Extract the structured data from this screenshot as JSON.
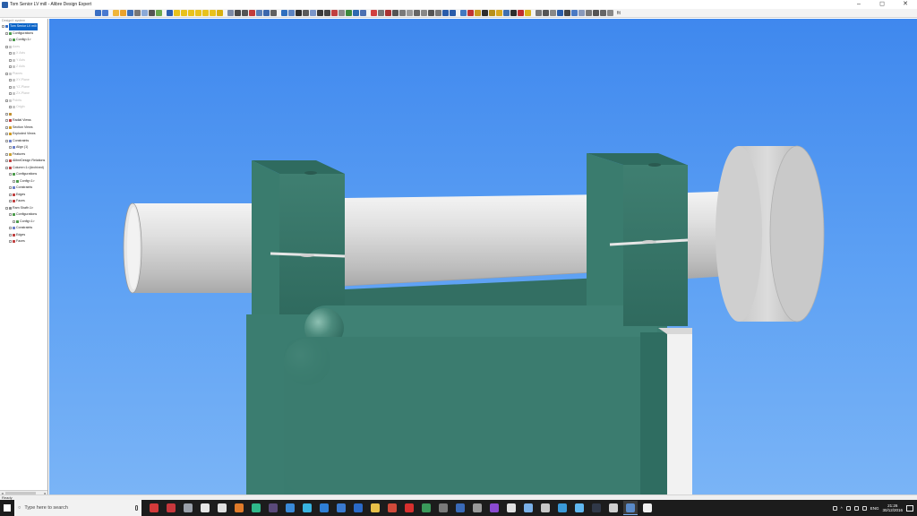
{
  "window": {
    "title": "Tom Senior LV mill - Alibre Design Expert",
    "controls": [
      "–",
      "◻",
      "✕"
    ]
  },
  "toolbar": {
    "zoom_label": "fit",
    "buttons": [
      {
        "icon": "select-icon",
        "color": "#3a6fc4"
      },
      {
        "icon": "undo-icon",
        "color": "#4a7ad0"
      },
      {
        "sep": true
      },
      {
        "icon": "new-icon",
        "color": "#f0b63a"
      },
      {
        "icon": "open-folder-icon",
        "color": "#e9a22e"
      },
      {
        "icon": "save-icon",
        "color": "#3d6fb8"
      },
      {
        "icon": "print-icon",
        "color": "#777777"
      },
      {
        "icon": "sphere-icon",
        "color": "#8aa9d8"
      },
      {
        "icon": "cut-icon",
        "color": "#555555"
      },
      {
        "icon": "leaf-icon",
        "color": "#6aa84f"
      },
      {
        "sep": true
      },
      {
        "icon": "pointer-icon",
        "color": "#2f5fb0"
      },
      {
        "icon": "frame-icon",
        "color": "#e8c21c"
      },
      {
        "icon": "frame-icon",
        "color": "#e8c21c"
      },
      {
        "icon": "frame-icon",
        "color": "#e8c21c"
      },
      {
        "icon": "frame-icon",
        "color": "#e8c21c"
      },
      {
        "icon": "frame-icon",
        "color": "#e8c21c"
      },
      {
        "icon": "frame-icon",
        "color": "#e8c21c"
      },
      {
        "icon": "frame-icon",
        "color": "#d8b010"
      },
      {
        "sep": true
      },
      {
        "icon": "grid-icon",
        "color": "#7c8aa6"
      },
      {
        "icon": "rotate-icon",
        "color": "#4a4a4a"
      },
      {
        "icon": "pan-icon",
        "color": "#555555"
      },
      {
        "icon": "flask-icon",
        "color": "#c23c3c"
      },
      {
        "icon": "view-icon",
        "color": "#5a7fb8"
      },
      {
        "icon": "view-icon",
        "color": "#3b67ad"
      },
      {
        "icon": "zoom-icon",
        "color": "#606060"
      },
      {
        "sep": true
      },
      {
        "icon": "measure-icon",
        "color": "#2e6fbf"
      },
      {
        "icon": "cube-icon",
        "color": "#5b83c2"
      },
      {
        "icon": "cube-icon",
        "color": "#2f2f2f"
      },
      {
        "icon": "cube-icon",
        "color": "#5a5a5a"
      },
      {
        "icon": "cube-icon",
        "color": "#7a95c8"
      },
      {
        "icon": "axis-icon",
        "color": "#3a3a3a"
      },
      {
        "icon": "axis-icon",
        "color": "#444444"
      },
      {
        "icon": "plane-icon",
        "color": "#c04040"
      },
      {
        "icon": "plane-icon",
        "color": "#8a8a8a"
      },
      {
        "icon": "curve-icon",
        "color": "#3c8a3c"
      },
      {
        "icon": "grid-icon",
        "color": "#2e6ab0"
      },
      {
        "icon": "grid-icon",
        "color": "#4c70b2"
      },
      {
        "sep": true
      },
      {
        "icon": "sketch-icon",
        "color": "#d04040"
      },
      {
        "icon": "render-icon",
        "color": "#777777"
      },
      {
        "icon": "render-icon",
        "color": "#aa3333"
      },
      {
        "icon": "render-icon",
        "color": "#555555"
      },
      {
        "icon": "render-icon",
        "color": "#7a7a7a"
      },
      {
        "icon": "render-icon",
        "color": "#999999"
      },
      {
        "icon": "render-icon",
        "color": "#666666"
      },
      {
        "icon": "render-icon",
        "color": "#888888"
      },
      {
        "icon": "render-icon",
        "color": "#555555"
      },
      {
        "icon": "render-icon",
        "color": "#777777"
      },
      {
        "icon": "render-icon",
        "color": "#2a5caa"
      },
      {
        "icon": "render-icon",
        "color": "#2a5caa"
      },
      {
        "sep": true
      },
      {
        "icon": "move-icon",
        "color": "#4478c0"
      },
      {
        "icon": "constraint-icon",
        "color": "#c03434"
      },
      {
        "icon": "constraint-icon",
        "color": "#c89a20"
      },
      {
        "icon": "constraint-icon",
        "color": "#2f2f2f"
      },
      {
        "icon": "constraint-icon",
        "color": "#b8901c"
      },
      {
        "icon": "constraint-icon",
        "color": "#d8a820"
      },
      {
        "icon": "constraint-icon",
        "color": "#3f6fb0"
      },
      {
        "icon": "constraint-icon",
        "color": "#2d2d2d"
      },
      {
        "icon": "constraint-icon",
        "color": "#c02e2e"
      },
      {
        "icon": "constraint-icon",
        "color": "#d9b21b"
      },
      {
        "sep": true
      },
      {
        "icon": "tool-icon",
        "color": "#777777"
      },
      {
        "icon": "tool-icon",
        "color": "#555555"
      },
      {
        "icon": "tool-icon",
        "color": "#888888"
      },
      {
        "icon": "tool-icon",
        "color": "#2a5ca8"
      },
      {
        "icon": "tool-icon",
        "color": "#444444"
      },
      {
        "icon": "tool-icon",
        "color": "#4a7ac4"
      },
      {
        "icon": "tool-icon",
        "color": "#8899bb"
      },
      {
        "icon": "tool-icon",
        "color": "#777777"
      },
      {
        "icon": "tool-icon",
        "color": "#555555"
      },
      {
        "icon": "tool-icon",
        "color": "#666666"
      },
      {
        "icon": "tool-icon",
        "color": "#888888"
      }
    ]
  },
  "sidebar": {
    "caption": "DesignX system",
    "tree": [
      {
        "label": "Tom Senior LV mill",
        "level": 0,
        "selected": true,
        "disabled": false,
        "icon_color": "#3a6fc4"
      },
      {
        "label": "Configurations",
        "level": 1,
        "selected": false,
        "disabled": false,
        "icon_color": "#4a9a4a"
      },
      {
        "label": "Config<1>",
        "level": 2,
        "selected": false,
        "disabled": false,
        "icon_color": "#4a9a4a"
      },
      {
        "label": "Axes",
        "level": 1,
        "selected": false,
        "disabled": true,
        "icon_color": "#c8c8c8"
      },
      {
        "label": "X Axis",
        "level": 2,
        "selected": false,
        "disabled": true,
        "icon_color": "#c8c8c8"
      },
      {
        "label": "Y Axis",
        "level": 2,
        "selected": false,
        "disabled": true,
        "icon_color": "#c8c8c8"
      },
      {
        "label": "Z Axis",
        "level": 2,
        "selected": false,
        "disabled": true,
        "icon_color": "#c8c8c8"
      },
      {
        "label": "Planes",
        "level": 1,
        "selected": false,
        "disabled": true,
        "icon_color": "#c8c8c8"
      },
      {
        "label": "XY-Plane",
        "level": 2,
        "selected": false,
        "disabled": true,
        "icon_color": "#c8c8c8"
      },
      {
        "label": "YZ-Plane",
        "level": 2,
        "selected": false,
        "disabled": true,
        "icon_color": "#c8c8c8"
      },
      {
        "label": "ZX-Plane",
        "level": 2,
        "selected": false,
        "disabled": true,
        "icon_color": "#c8c8c8"
      },
      {
        "label": "Points",
        "level": 1,
        "selected": false,
        "disabled": true,
        "icon_color": "#c8c8c8"
      },
      {
        "label": "Origin",
        "level": 2,
        "selected": false,
        "disabled": true,
        "icon_color": "#c8c8c8"
      },
      {
        "label": "",
        "level": 1,
        "selected": false,
        "disabled": false,
        "icon_color": "#c09030"
      },
      {
        "label": "Radial Views",
        "level": 1,
        "selected": false,
        "disabled": false,
        "icon_color": "#c04040"
      },
      {
        "label": "Section Views",
        "level": 1,
        "selected": false,
        "disabled": false,
        "icon_color": "#d09a20"
      },
      {
        "label": "Exploded Views",
        "level": 1,
        "selected": false,
        "disabled": false,
        "icon_color": "#d09a20"
      },
      {
        "label": "Constraints",
        "level": 1,
        "selected": false,
        "disabled": false,
        "icon_color": "#6a7fc8"
      },
      {
        "label": "Align (1)",
        "level": 2,
        "selected": false,
        "disabled": false,
        "icon_color": "#6a7fc8"
      },
      {
        "label": "Features",
        "level": 1,
        "selected": false,
        "disabled": false,
        "icon_color": "#c8a030"
      },
      {
        "label": "AlibreDesign Relations",
        "level": 1,
        "selected": false,
        "disabled": false,
        "icon_color": "#c04040"
      },
      {
        "label": "Column<1>(Archived)",
        "level": 1,
        "selected": false,
        "disabled": false,
        "icon_color": "#c04040"
      },
      {
        "label": "Configurations",
        "level": 2,
        "selected": false,
        "disabled": false,
        "icon_color": "#4a9a4a"
      },
      {
        "label": "Config<1>",
        "level": 3,
        "selected": false,
        "disabled": false,
        "icon_color": "#4a9a4a"
      },
      {
        "label": "Constraints",
        "level": 2,
        "selected": false,
        "disabled": false,
        "icon_color": "#6a7fc8"
      },
      {
        "label": "Edges",
        "level": 2,
        "selected": false,
        "disabled": false,
        "icon_color": "#c04040"
      },
      {
        "label": "Faces",
        "level": 2,
        "selected": false,
        "disabled": false,
        "icon_color": "#c04040"
      },
      {
        "label": "Ram Shaft<1>",
        "level": 1,
        "selected": false,
        "disabled": false,
        "icon_color": "#8a8a8a"
      },
      {
        "label": "Configurations",
        "level": 2,
        "selected": false,
        "disabled": false,
        "icon_color": "#4a9a4a"
      },
      {
        "label": "Config<1>",
        "level": 3,
        "selected": false,
        "disabled": false,
        "icon_color": "#4a9a4a"
      },
      {
        "label": "Constraints",
        "level": 2,
        "selected": false,
        "disabled": false,
        "icon_color": "#6a7fc8"
      },
      {
        "label": "Edges",
        "level": 2,
        "selected": false,
        "disabled": false,
        "icon_color": "#c04040"
      },
      {
        "label": "Faces",
        "level": 2,
        "selected": false,
        "disabled": false,
        "icon_color": "#c04040"
      }
    ]
  },
  "status": {
    "text": "Ready"
  },
  "taskbar": {
    "search_placeholder": "Type here to search",
    "apps": [
      {
        "icon": "app-red-b-icon",
        "color": "#d43a3a",
        "active": false
      },
      {
        "icon": "app-red-icon",
        "color": "#c8373c",
        "active": false
      },
      {
        "icon": "app-file-icon",
        "color": "#9aa0aa",
        "active": false
      },
      {
        "icon": "app-doc-icon",
        "color": "#e6e6e6",
        "active": false
      },
      {
        "icon": "gear-icon",
        "color": "#e0e0e0",
        "active": false
      },
      {
        "icon": "app-orange-icon",
        "color": "#e07b2a",
        "active": false
      },
      {
        "icon": "app-green-icon",
        "color": "#2fb98a",
        "active": false
      },
      {
        "icon": "app-dark-icon",
        "color": "#5a4a7a",
        "active": false
      },
      {
        "icon": "app-blue-icon",
        "color": "#3a8ad8",
        "active": false
      },
      {
        "icon": "app-cyan-icon",
        "color": "#38b4e0",
        "active": false
      },
      {
        "icon": "edge-icon",
        "color": "#2f7fd6",
        "active": false
      },
      {
        "icon": "store-icon",
        "color": "#3a7ad0",
        "active": false
      },
      {
        "icon": "mail-icon",
        "color": "#2a6ac8",
        "active": false
      },
      {
        "icon": "folder-icon",
        "color": "#e8c048",
        "active": false
      },
      {
        "icon": "chrome-icon",
        "color": "#d04a3a",
        "active": false
      },
      {
        "icon": "app-red-a-icon",
        "color": "#d8302e",
        "active": false
      },
      {
        "icon": "app-circle-icon",
        "color": "#3a9a5a",
        "active": false
      },
      {
        "icon": "app-grey-icon",
        "color": "#7a7a7a",
        "active": false
      },
      {
        "icon": "app-blue2-icon",
        "color": "#3a6ab8",
        "active": false
      },
      {
        "icon": "app-grey2-icon",
        "color": "#9a9a9a",
        "active": false
      },
      {
        "icon": "app-purple-icon",
        "color": "#8a4ad0",
        "active": false
      },
      {
        "icon": "app-light-icon",
        "color": "#e0e0e0",
        "active": false
      },
      {
        "icon": "app-lightblue-icon",
        "color": "#7ab0e8",
        "active": false
      },
      {
        "icon": "app-img-icon",
        "color": "#c8c8c8",
        "active": false
      },
      {
        "icon": "app-shield-icon",
        "color": "#3a9ad8",
        "active": false
      },
      {
        "icon": "app-sky-icon",
        "color": "#60b8f0",
        "active": false
      },
      {
        "icon": "app-dark2-icon",
        "color": "#303848",
        "active": false
      },
      {
        "icon": "app-pale-icon",
        "color": "#d0d0d0",
        "active": false
      },
      {
        "icon": "alibre-icon",
        "color": "#5a8ac8",
        "active": true
      },
      {
        "icon": "app-white-icon",
        "color": "#f0f0f0",
        "active": false
      }
    ],
    "tray": {
      "language": "ENG",
      "time": "21:26",
      "date": "30/12/2016"
    }
  },
  "colors": {
    "machine_green": "#3d7c6f",
    "shaft_grey": "#d8d8d8",
    "viewport_top": "#3f88ee",
    "viewport_bottom": "#7ab4f6"
  }
}
